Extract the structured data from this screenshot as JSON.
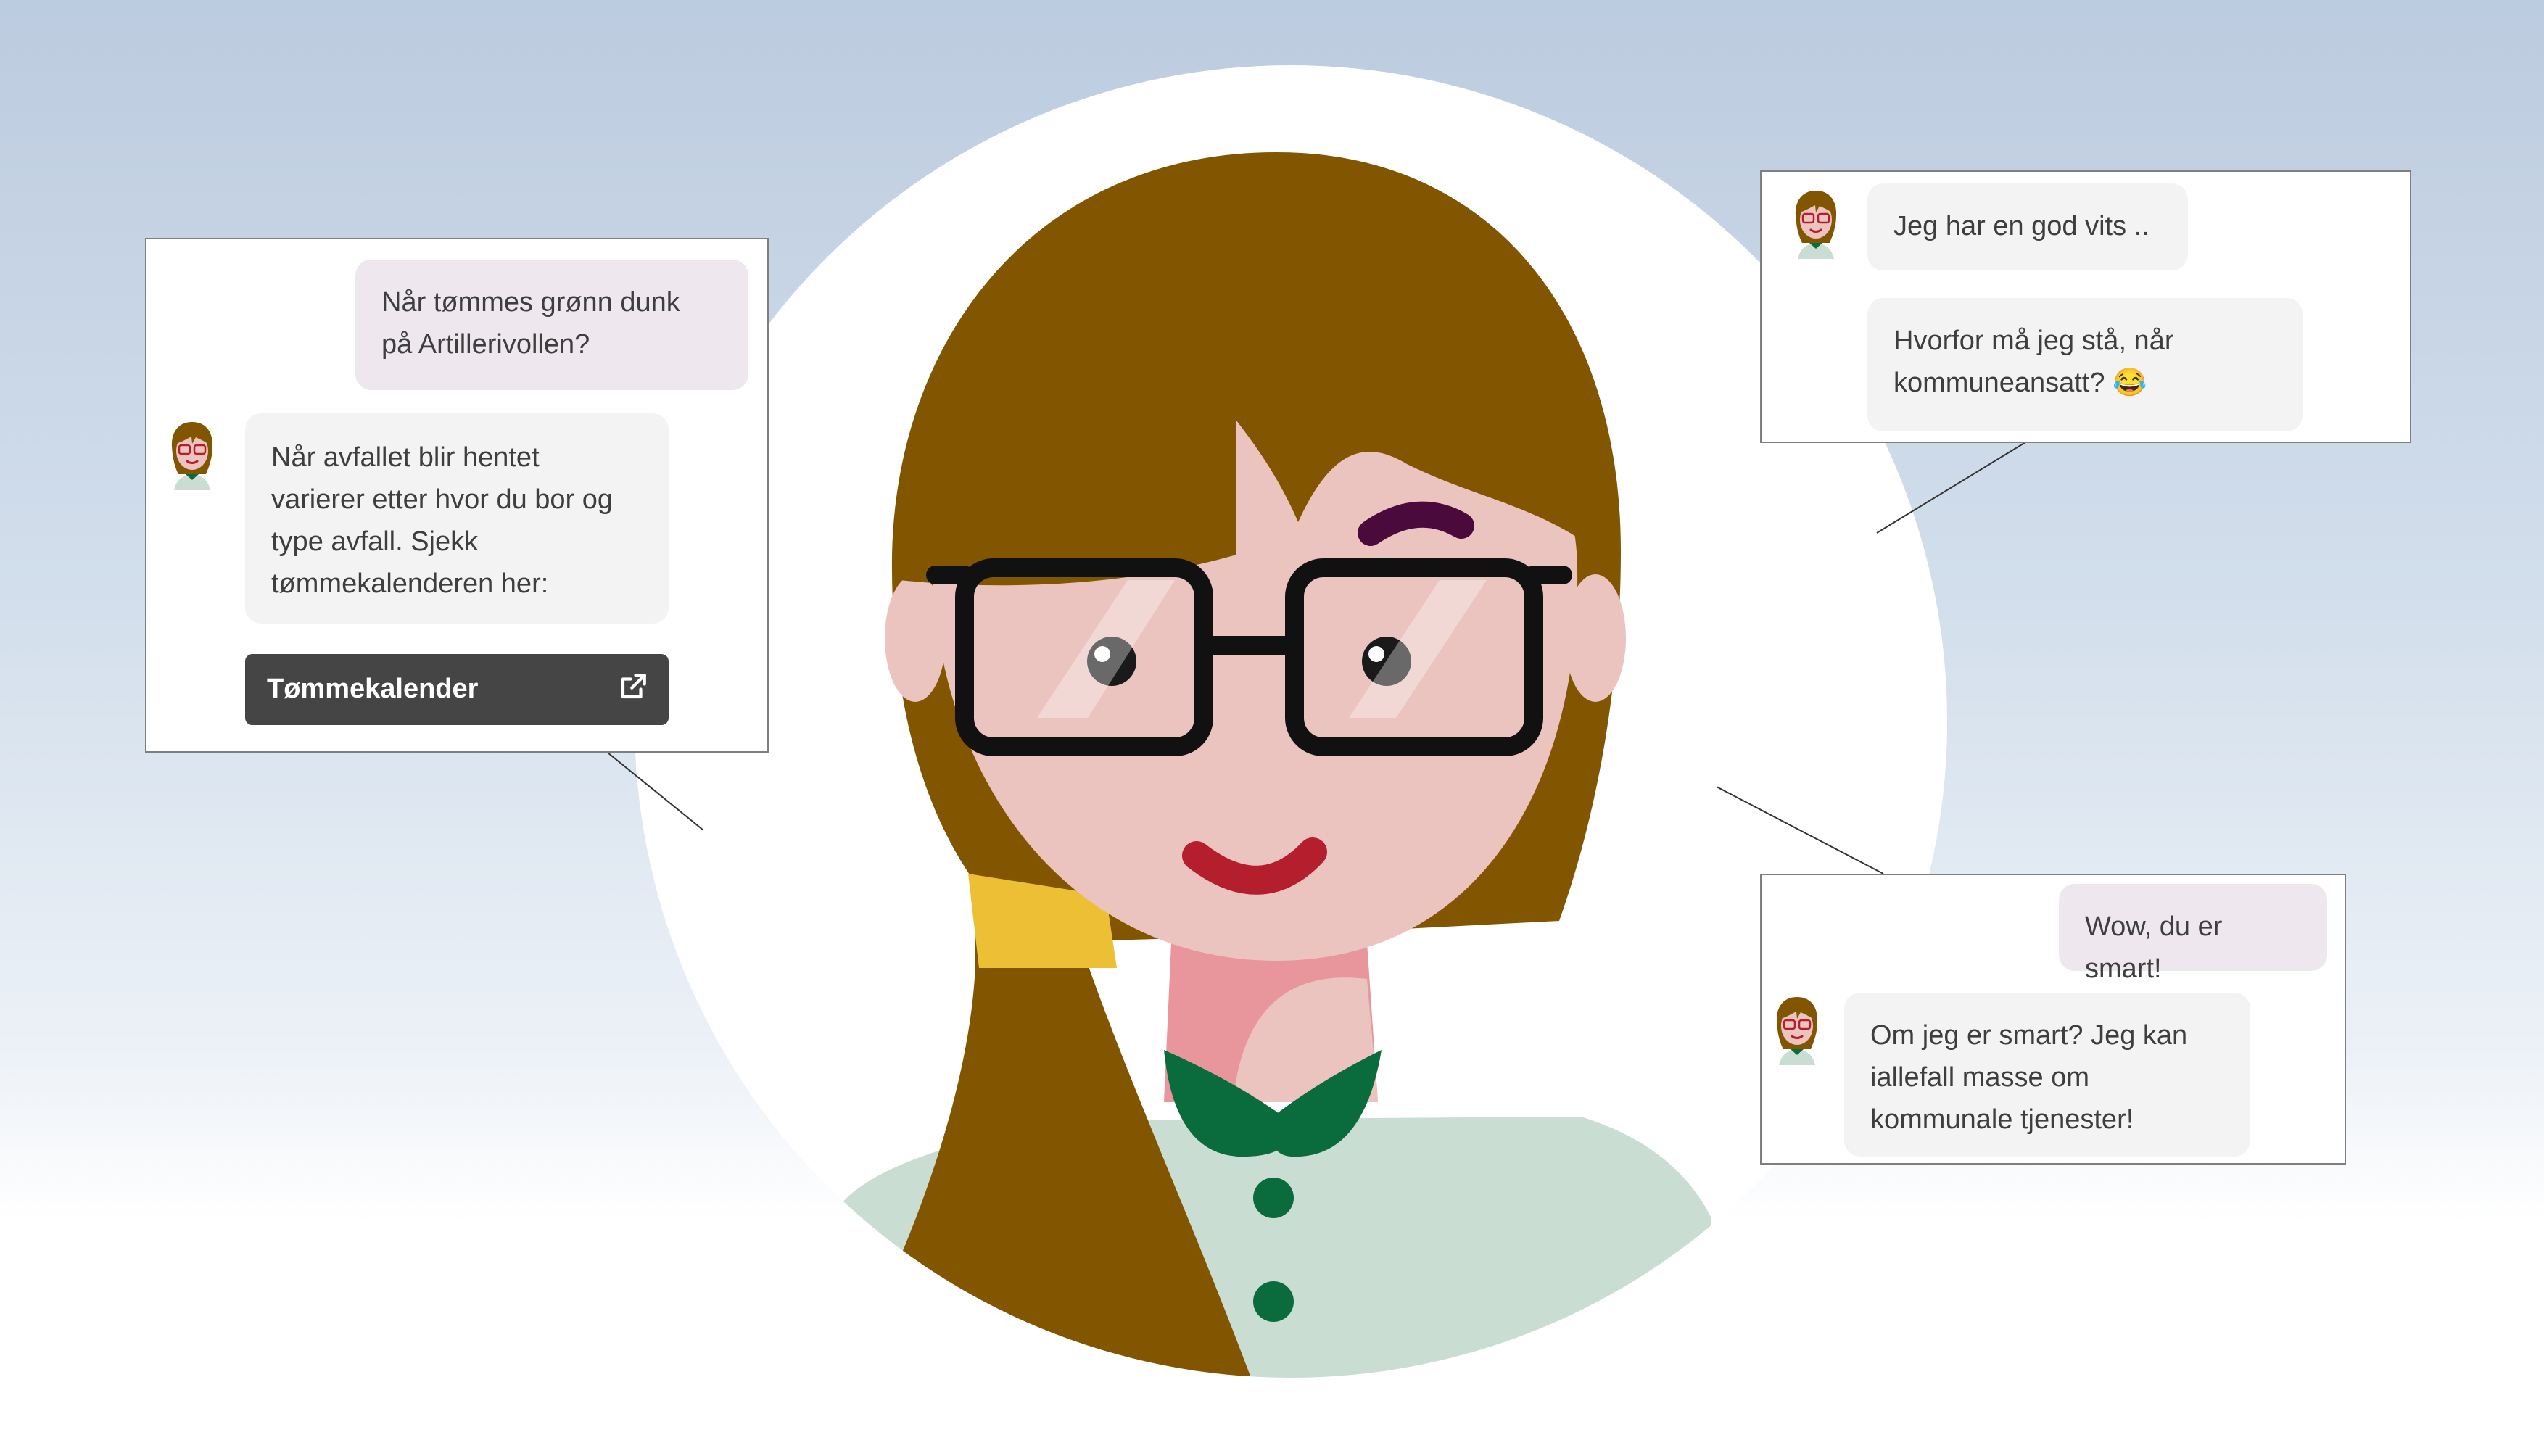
{
  "colors": {
    "hair": "#825500",
    "skin": "#ebc3bf",
    "glasses": "#111111",
    "lips": "#b41e2d",
    "eyebrow": "#4a0a3c",
    "collar": "#0a6b3c",
    "shirt": "#c9ddd3",
    "neck": "#e8959b",
    "hair_tie": "#edbf35",
    "user_bubble": "#eee8ee",
    "bot_bubble": "#f3f3f3",
    "button": "#454545"
  },
  "panel_left": {
    "user_message": [
      "Når tømmes grønn dunk",
      "på Artillerivollen?"
    ],
    "bot_message": [
      "Når avfallet blir hentet",
      "varierer etter hvor du bor og",
      "type avfall. Sjekk",
      "tømmekalenderen her:"
    ],
    "button_label": "Tømmekalender",
    "button_icon": "external-link-icon"
  },
  "panel_top_right": {
    "bot_message_1": [
      "Jeg har en god vits .."
    ],
    "bot_message_2": [
      "Hvorfor må jeg stå, når",
      "kommuneansatt? 😂"
    ]
  },
  "panel_bottom_right": {
    "user_message": [
      "Wow, du er smart!"
    ],
    "bot_message": [
      "Om jeg er smart? Jeg kan",
      "iallefall masse om",
      "kommunale tjenester!"
    ]
  }
}
